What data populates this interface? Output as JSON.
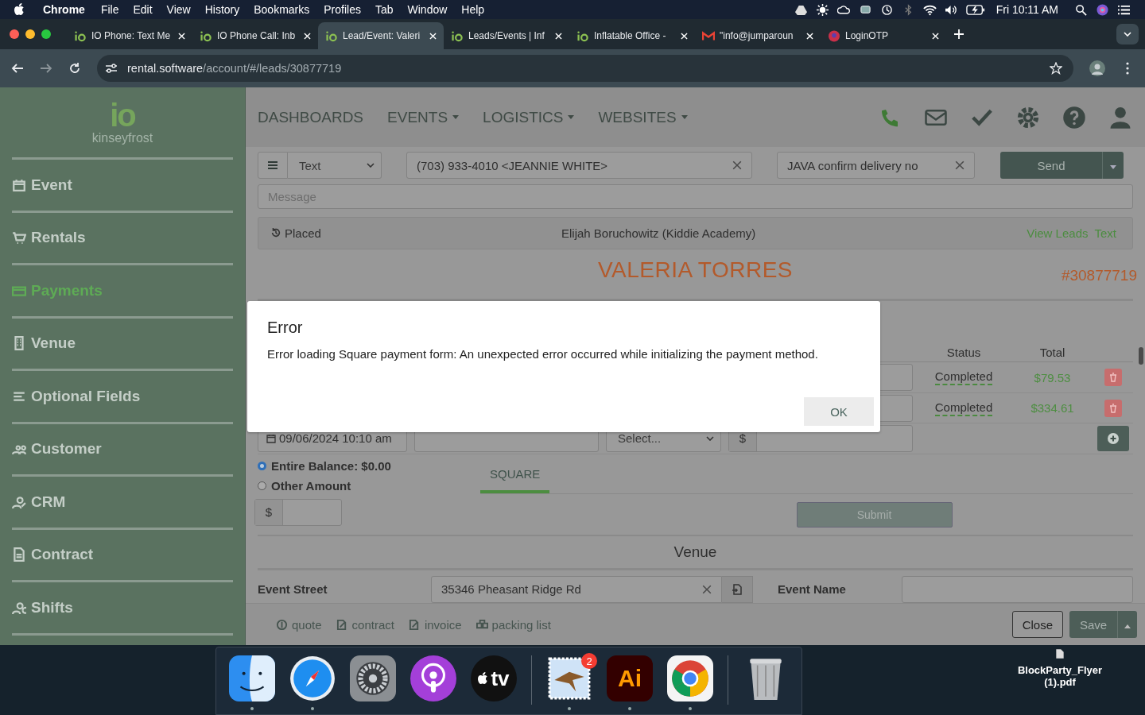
{
  "menubar": {
    "app": "Chrome",
    "menus": [
      "File",
      "Edit",
      "View",
      "History",
      "Bookmarks",
      "Profiles",
      "Tab",
      "Window",
      "Help"
    ],
    "clock": "Fri 10:11 AM"
  },
  "browser": {
    "tabs": [
      {
        "title": "IO Phone: Text Me",
        "selected": false
      },
      {
        "title": "IO Phone Call: Inb",
        "selected": false
      },
      {
        "title": "Lead/Event: Valeri",
        "selected": true
      },
      {
        "title": "Leads/Events | Inf",
        "selected": false
      },
      {
        "title": "Inflatable Office -",
        "selected": false
      },
      {
        "title": "\"info@jumparoun",
        "selected": false
      },
      {
        "title": "LoginOTP",
        "selected": false
      }
    ],
    "url_host": "rental.software",
    "url_path": "/account/#/leads/30877719"
  },
  "sidebar": {
    "logo": "io",
    "account": "kinseyfrost",
    "items": [
      {
        "label": "Event",
        "selected": false
      },
      {
        "label": "Rentals",
        "selected": false
      },
      {
        "label": "Payments",
        "selected": true
      },
      {
        "label": "Venue",
        "selected": false
      },
      {
        "label": "Optional Fields",
        "selected": false
      },
      {
        "label": "Customer",
        "selected": false
      },
      {
        "label": "CRM",
        "selected": false
      },
      {
        "label": "Contract",
        "selected": false
      },
      {
        "label": "Shifts",
        "selected": false
      }
    ]
  },
  "nav": {
    "items": [
      {
        "label": "DASHBOARDS",
        "dropdown": false
      },
      {
        "label": "EVENTS",
        "dropdown": true
      },
      {
        "label": "LOGISTICS",
        "dropdown": true
      },
      {
        "label": "WEBSITES",
        "dropdown": true
      }
    ]
  },
  "message_bar": {
    "type": "Text",
    "recipient": "(703) 933-4010 <JEANNIE WHITE>",
    "template": "JAVA confirm delivery no",
    "send": "Send",
    "placeholder": "Message"
  },
  "info_bar": {
    "status": "Placed",
    "contact": "Elijah Boruchowitz (Kiddie Academy)",
    "links": [
      "View Leads",
      "Text"
    ]
  },
  "lead": {
    "name": "VALERIA TORRES",
    "number": "#30877719"
  },
  "payments": {
    "columns": [
      "Status",
      "Total"
    ],
    "rows": [
      {
        "status": "Completed",
        "total": "$79.53"
      },
      {
        "status": "Completed",
        "total": "$334.61"
      }
    ],
    "new_row": {
      "date": "09/06/2024 10:10 am",
      "method_placeholder": "Select...",
      "currency": "$"
    },
    "options": [
      {
        "label": "Entire Balance: $0.00",
        "selected": true
      },
      {
        "label": "Other Amount",
        "selected": false
      }
    ],
    "amount_currency": "$",
    "tabs": [
      {
        "label": "SQUARE",
        "selected": true
      }
    ],
    "submit": "Submit"
  },
  "venue": {
    "title": "Venue",
    "street_label": "Event Street",
    "street": "35346 Pheasant Ridge Rd",
    "name_label": "Event Name"
  },
  "footer": {
    "links": [
      "quote",
      "contract",
      "invoice",
      "packing list"
    ],
    "close": "Close",
    "save": "Save"
  },
  "dialog": {
    "title": "Error",
    "message": "Error loading Square payment form: An unexpected error occurred while initializing the payment method.",
    "button": "OK"
  },
  "dock": {
    "items": [
      {
        "kind": "finder",
        "running": true
      },
      {
        "kind": "safari",
        "running": true
      },
      {
        "kind": "settings",
        "running": false
      },
      {
        "kind": "podcasts",
        "running": false
      },
      {
        "kind": "tv",
        "label": "tv",
        "running": false
      },
      {
        "kind": "mail",
        "badge": "2",
        "running": true
      },
      {
        "kind": "illustrator",
        "label": "Ai",
        "running": true
      },
      {
        "kind": "chrome",
        "running": true
      },
      {
        "kind": "trash",
        "running": false
      }
    ]
  },
  "desktop": {
    "file": "BlockParty_Flyer (1).pdf"
  }
}
